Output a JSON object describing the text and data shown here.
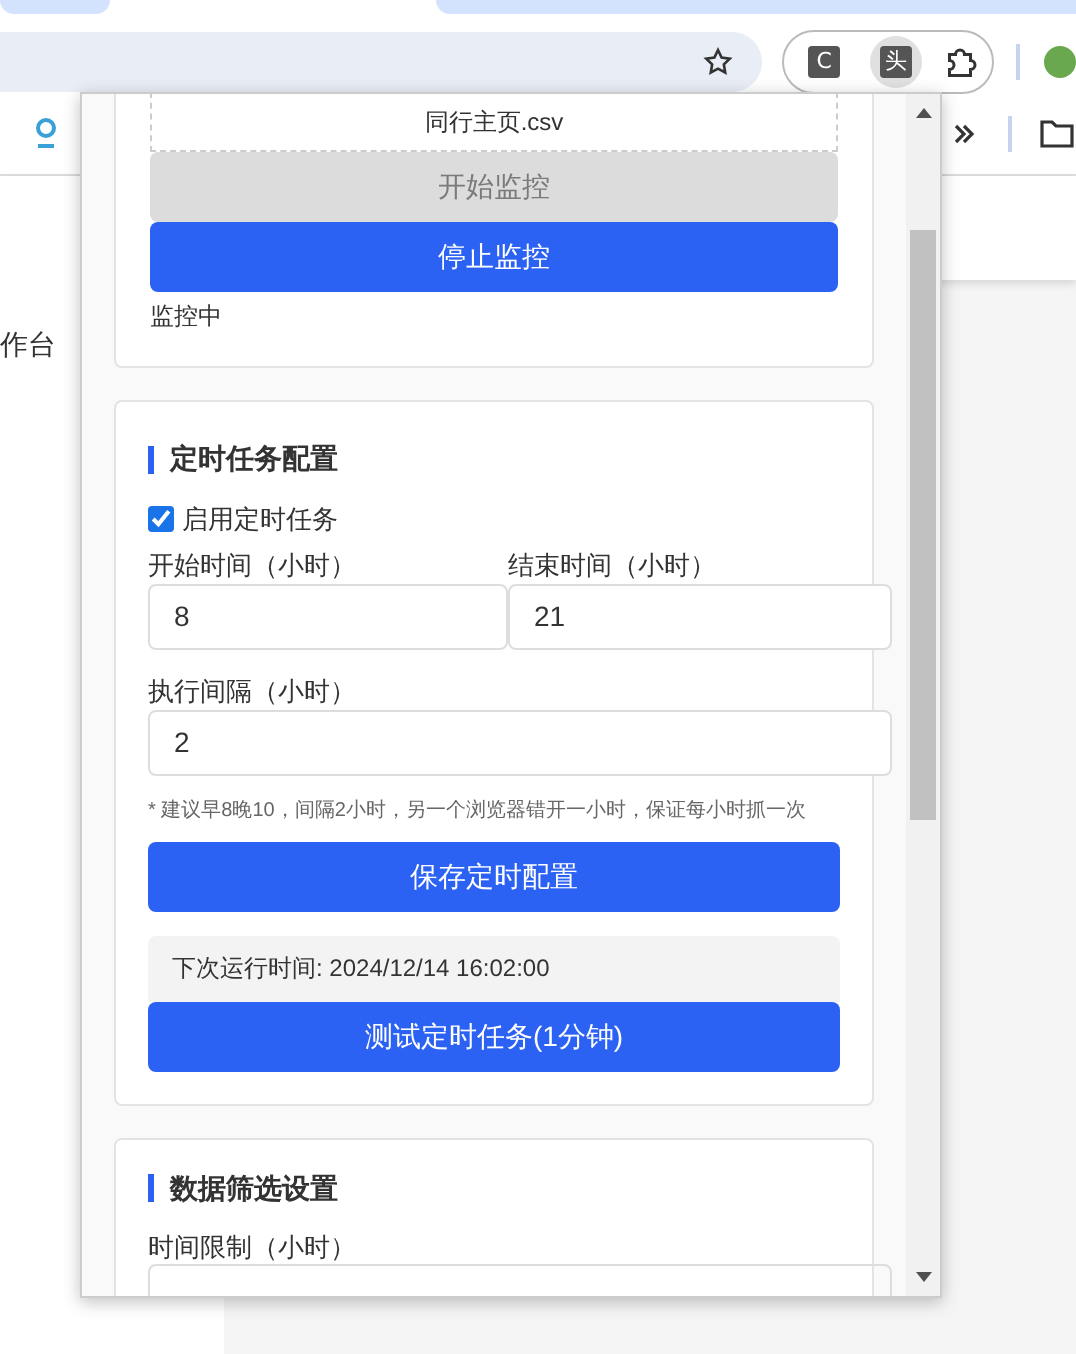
{
  "browser": {
    "extensions": [
      {
        "label": "C",
        "selected": false
      },
      {
        "label": "头",
        "selected": true
      }
    ]
  },
  "background_page": {
    "nav_text": "作台"
  },
  "popup": {
    "monitor_card": {
      "file_name": "同行主页.csv",
      "buttons": [
        {
          "label": "开始监控",
          "disabled": true
        },
        {
          "label": "停止监控",
          "disabled": false
        }
      ],
      "status": "监控中"
    },
    "schedule_card": {
      "title": "定时任务配置",
      "enable": {
        "label": "启用定时任务",
        "checked": true
      },
      "start": {
        "label": "开始时间（小时）",
        "value": "8"
      },
      "end": {
        "label": "结束时间（小时）",
        "value": "21"
      },
      "interval": {
        "label": "执行间隔（小时）",
        "value": "2"
      },
      "hint": "* 建议早8晚10，间隔2小时，另一个浏览器错开一小时，保证每小时抓一次",
      "save_button": "保存定时配置",
      "next_run": "下次运行时间: 2024/12/14 16:02:00",
      "test_button": "测试定时任务(1分钟)"
    },
    "filter_card": {
      "title": "数据筛选设置",
      "time_limit_label": "时间限制（小时）"
    }
  }
}
